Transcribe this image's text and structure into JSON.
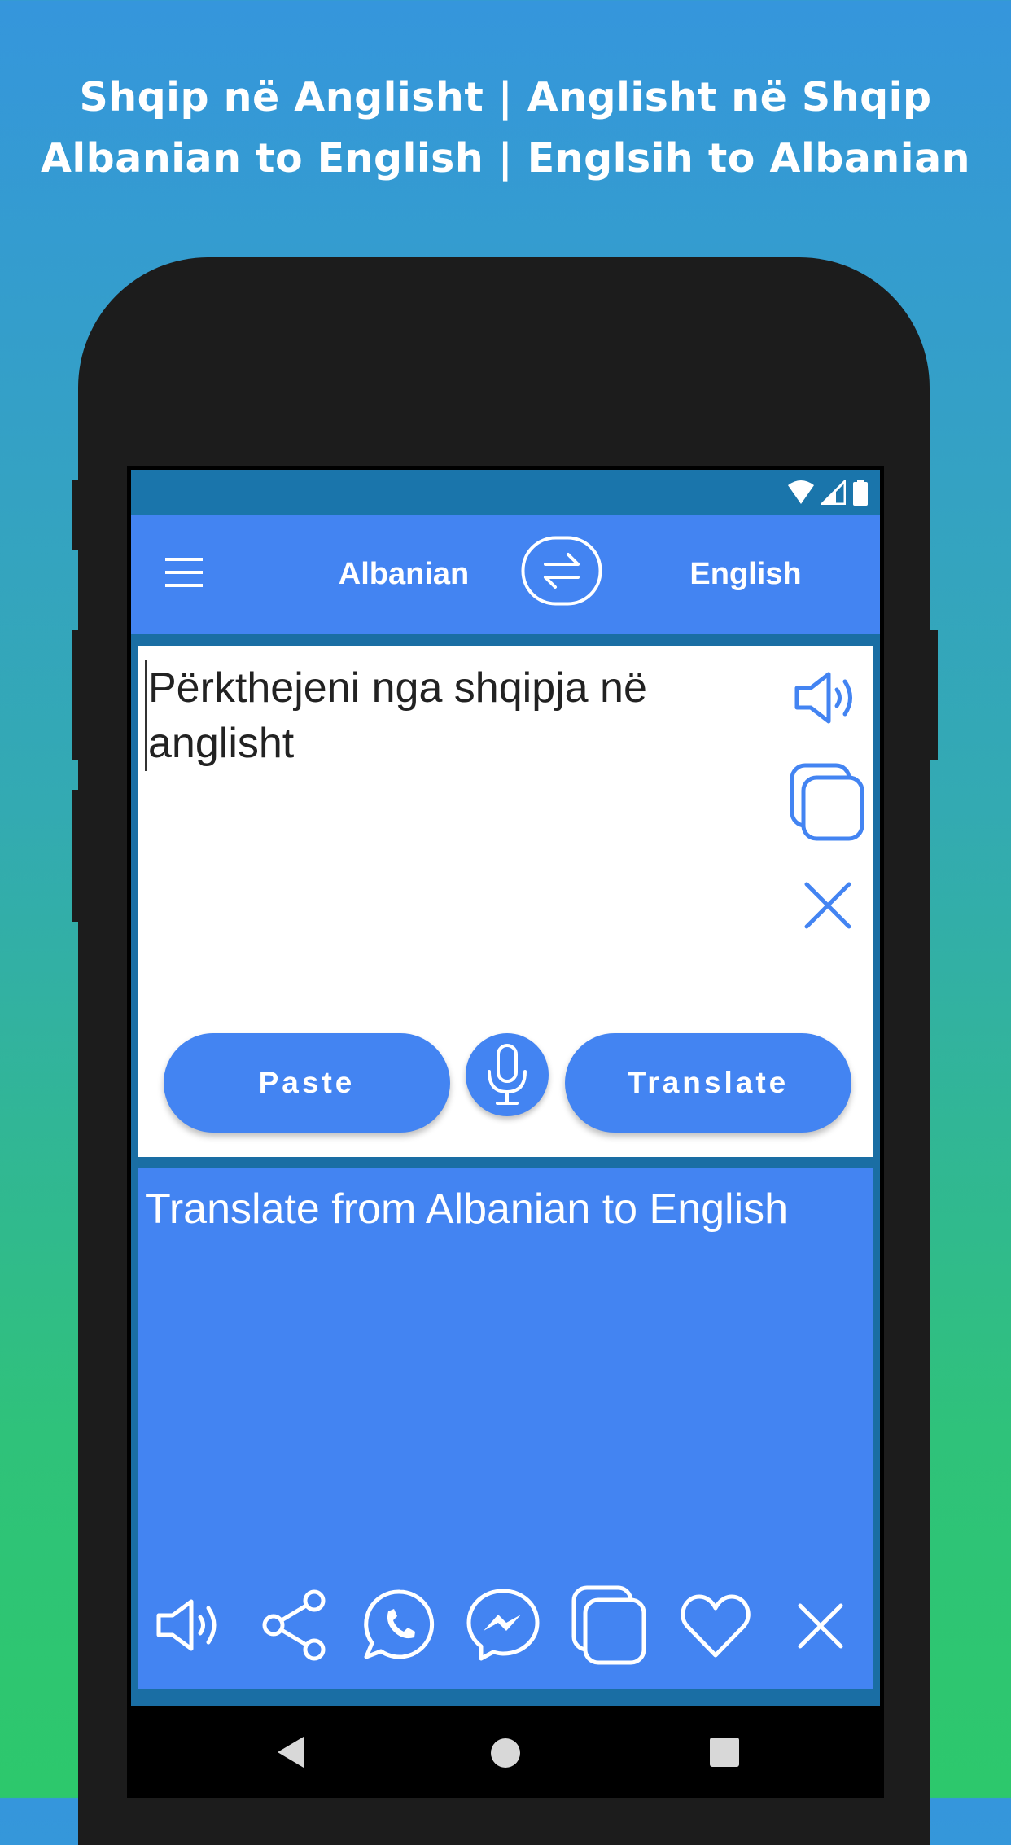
{
  "promo": {
    "line1": "Shqip në Anglisht | Anglisht në Shqip",
    "line2": "Albanian to English | Englsih to Albanian"
  },
  "statusbar": {
    "icons": [
      "wifi-icon",
      "signal-icon",
      "battery-icon"
    ]
  },
  "appbar": {
    "menu_icon": "hamburger-menu-icon",
    "source_language": "Albanian",
    "swap_icon": "swap-arrows-icon",
    "target_language": "English"
  },
  "input": {
    "text": "Përkthejeni nga shqipja në anglisht",
    "side_icons": [
      "speaker-icon",
      "copy-icon",
      "close-icon"
    ],
    "paste_label": "Paste",
    "mic_icon": "microphone-icon",
    "translate_label": "Translate"
  },
  "output": {
    "text": "Translate from Albanian to English",
    "actions": [
      "speaker-icon",
      "share-icon",
      "whatsapp-icon",
      "messenger-icon",
      "copy-icon",
      "heart-icon",
      "close-icon"
    ]
  },
  "navbar": {
    "icons": [
      "back-icon",
      "home-icon",
      "recents-icon"
    ]
  },
  "colors": {
    "accent": "#4384f2",
    "status_bar": "#1a75ab",
    "phone_body": "#1c1c1c",
    "background_top": "#3596dc",
    "background_bottom": "#2dc86c"
  }
}
